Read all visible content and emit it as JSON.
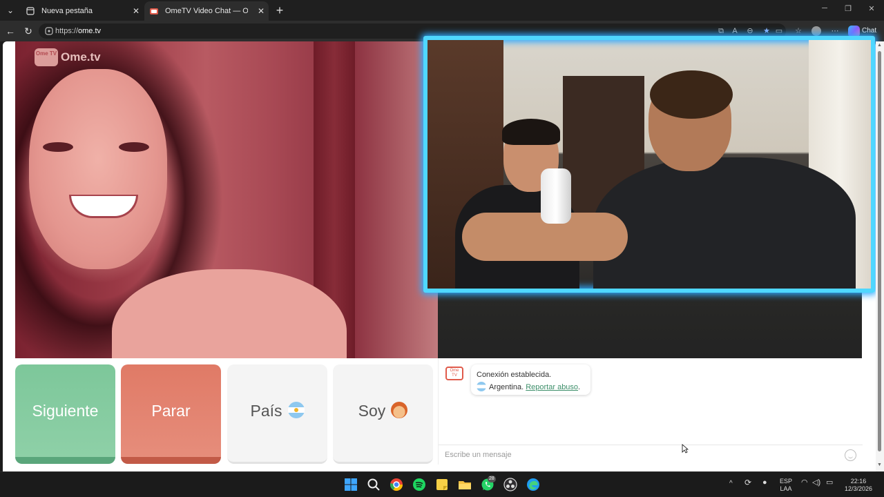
{
  "browser": {
    "tabs": [
      {
        "title": "Nueva pestaña",
        "active": false
      },
      {
        "title": "OmeTV Video Chat — Omegle",
        "active": true
      }
    ],
    "url_prefix": "https://",
    "url_host": "ome.tv",
    "chat_button": "Chat"
  },
  "ometv": {
    "logo_text": "Ome.tv",
    "logo_badge": "Ome TV",
    "buttons": {
      "next": "Siguiente",
      "stop": "Parar",
      "country": "País",
      "gender": "Soy"
    },
    "chat": {
      "status": "Conexión establecida.",
      "country": "Argentina.",
      "report_link": "Reportar abuso",
      "report_suffix": ".",
      "input_placeholder": "Escribe un mensaje"
    },
    "colors": {
      "next": "#7dc79a",
      "stop": "#e07a66",
      "frame_glow": "#4fd7ff",
      "link": "#3d8f6a"
    }
  },
  "taskbar": {
    "whatsapp_badge": "28",
    "language": "ESP",
    "layout": "LAA",
    "time": "22:16",
    "date": "12/3/2026"
  }
}
